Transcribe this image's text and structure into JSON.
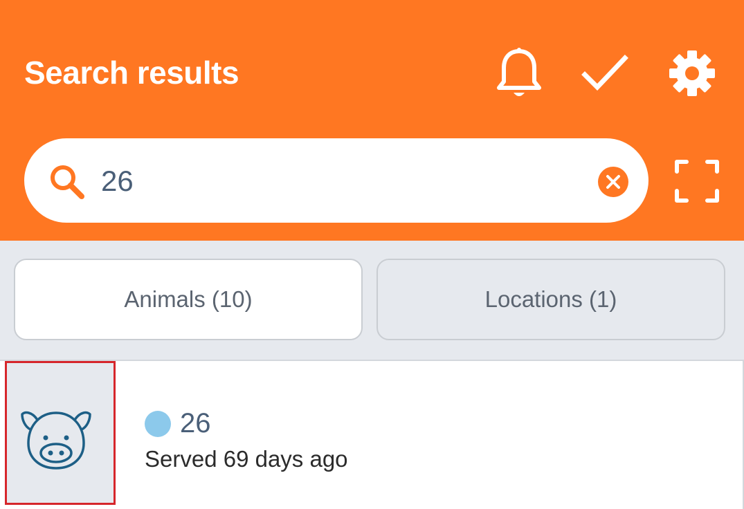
{
  "header": {
    "title": "Search results",
    "icons": [
      "bell-icon",
      "check-icon",
      "gear-icon"
    ],
    "accent_color": "#ff7722"
  },
  "search": {
    "value": "26",
    "icons": [
      "search-icon",
      "clear-icon",
      "scan-icon"
    ]
  },
  "tabs": [
    {
      "label": "Animals (10)",
      "selected": true
    },
    {
      "label": "Locations (1)",
      "selected": false
    }
  ],
  "results": [
    {
      "icon": "pig-icon",
      "status_dot_color": "#8cc9eb",
      "id": "26",
      "status": "Served 69 days ago"
    }
  ]
}
